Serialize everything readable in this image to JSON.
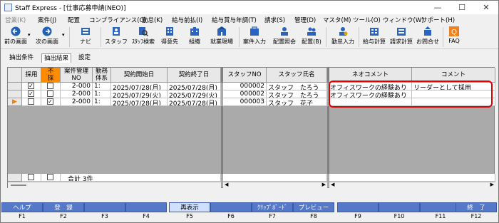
{
  "window": {
    "title": "Staff Express - [仕事応募申請(NEO)]",
    "minimize": "—",
    "maximize": "☐",
    "close": "✕"
  },
  "menu": [
    "営業(K)",
    "案件(J)",
    "配置",
    "コンプライアンス(C)",
    "勤怠(K)",
    "給与前払(I)",
    "給与賞与年調(T)",
    "請求(S)",
    "管理(D)",
    "マスタ(M)",
    "ツール(O)",
    "ウィンドウ(W)",
    "サポート(H)"
  ],
  "toolbar": [
    {
      "label": "前の画面",
      "icon": "back-arrow-icon"
    },
    {
      "label": "次の画面",
      "icon": "forward-arrow-icon"
    },
    {
      "label": "ナビ",
      "icon": "navi-icon"
    },
    {
      "label": "スタッフ",
      "icon": "staff-icon"
    },
    {
      "label": "ｽﾀｯﾌ検索",
      "icon": "staff-search-icon"
    },
    {
      "label": "得意先",
      "icon": "client-icon"
    },
    {
      "label": "組織",
      "icon": "organization-icon"
    },
    {
      "label": "就業現場",
      "icon": "worksite-icon"
    },
    {
      "label": "案件入力",
      "icon": "job-entry-icon"
    },
    {
      "label": "配置照会",
      "icon": "placement-inquiry-icon"
    },
    {
      "label": "配置(B)",
      "icon": "placement-icon"
    },
    {
      "label": "勤怠入力",
      "icon": "attendance-icon"
    },
    {
      "label": "給与計算",
      "icon": "payroll-icon"
    },
    {
      "label": "請求計算",
      "icon": "billing-icon"
    },
    {
      "label": "お問合せ",
      "icon": "inquiry-icon"
    },
    {
      "label": "FAQ",
      "icon": "faq-icon"
    }
  ],
  "tabs": [
    "抽出条件",
    "抽出結果",
    "設定"
  ],
  "grid": {
    "headers": [
      "採用",
      "不採用",
      "案件管理NO",
      "勤務体系",
      "契約開始日",
      "契約終了日",
      "スタッフNO",
      "スタッフ氏名",
      "ネオコメント",
      "コメント"
    ],
    "rows": [
      {
        "saiyo": "✓",
        "fusaiyo": "",
        "kanri": "2-000",
        "kinmu": "1:",
        "start": "2025/07/28(月)",
        "end": "2025/07/28(月)",
        "staff_no": "000002",
        "name": "スタッフ　たろう",
        "neo": "オフィスワークの経験あり",
        "comment": "リーダーとして採用"
      },
      {
        "saiyo": "✓",
        "fusaiyo": "",
        "kanri": "2-000",
        "kinmu": "1:",
        "start": "2025/07/29(火)",
        "end": "2025/07/29(火)",
        "staff_no": "000002",
        "name": "スタッフ　たろう",
        "neo": "オフィスワークの経験あり",
        "comment": ""
      },
      {
        "saiyo": "",
        "fusaiyo": "✓",
        "kanri": "2-000",
        "kinmu": "1:",
        "start": "2025/07/28(月)",
        "end": "2025/07/28(月)",
        "staff_no": "000003",
        "name": "スタッフ　花子",
        "neo": "",
        "comment": ""
      }
    ],
    "footer": "合計  3件"
  },
  "fkeys": [
    {
      "label": "ヘルプ",
      "key": "F1"
    },
    {
      "label": "登　録",
      "key": "F2"
    },
    {
      "label": "",
      "key": "F3"
    },
    {
      "label": "",
      "key": "F4"
    },
    {
      "label": "再表示",
      "key": "F5"
    },
    {
      "label": "",
      "key": "F6"
    },
    {
      "label": "ｸﾘｯﾌﾟﾎﾞｰﾄﾞ",
      "key": "F7"
    },
    {
      "label": "プレビュー",
      "key": "F8"
    },
    {
      "label": "",
      "key": "F9"
    },
    {
      "label": "",
      "key": "F10"
    },
    {
      "label": "",
      "key": "F11"
    },
    {
      "label": "終　了",
      "key": "F12"
    }
  ],
  "colors": {
    "fusaiyo_header": "#ff8c00",
    "fkey": "#5578c8",
    "highlight": "#e00000"
  }
}
